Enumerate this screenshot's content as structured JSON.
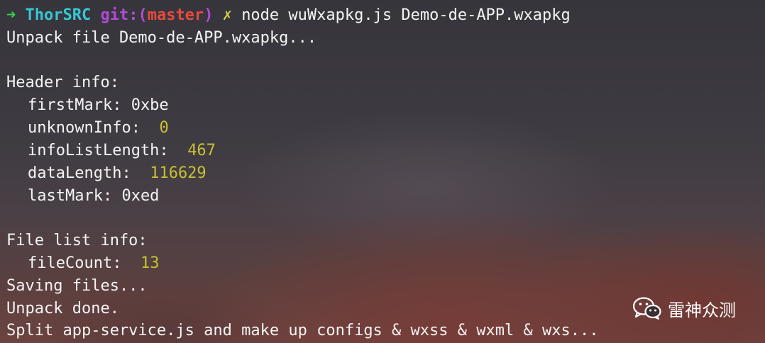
{
  "prompt": {
    "arrow": "➜",
    "host": "ThorSRC",
    "git_label": "git:(",
    "branch": "master",
    "git_close": ")",
    "dirty_mark": "✗",
    "command": "node wuWxapkg.js Demo-de-APP.wxapkg"
  },
  "output": {
    "unpack_line": "Unpack file Demo-de-APP.wxapkg...",
    "header_title": "Header info:",
    "first_mark_label": "firstMark: 0xbe",
    "unknown_info_label": "unknownInfo:",
    "unknown_info_value": "0",
    "info_list_length_label": "infoListLength:",
    "info_list_length_value": "467",
    "data_length_label": "dataLength:",
    "data_length_value": "116629",
    "last_mark_label": "lastMark: 0xed",
    "file_list_title": "File list info:",
    "file_count_label": "fileCount:",
    "file_count_value": "13",
    "saving_line": "Saving files...",
    "unpack_done_line": "Unpack done.",
    "split_line": "Split app-service.js and make up configs & wxss & wxml & wxs..."
  },
  "watermark": {
    "icon": "wechat-icon",
    "text": "雷神众测"
  },
  "colors": {
    "arrow": "#35d14c",
    "host": "#37c6d6",
    "git": "#b14bd6",
    "branch": "#e64a3f",
    "dirty_mark": "#d7d24a",
    "number": "#c8c031",
    "text": "#f4f4f4"
  }
}
